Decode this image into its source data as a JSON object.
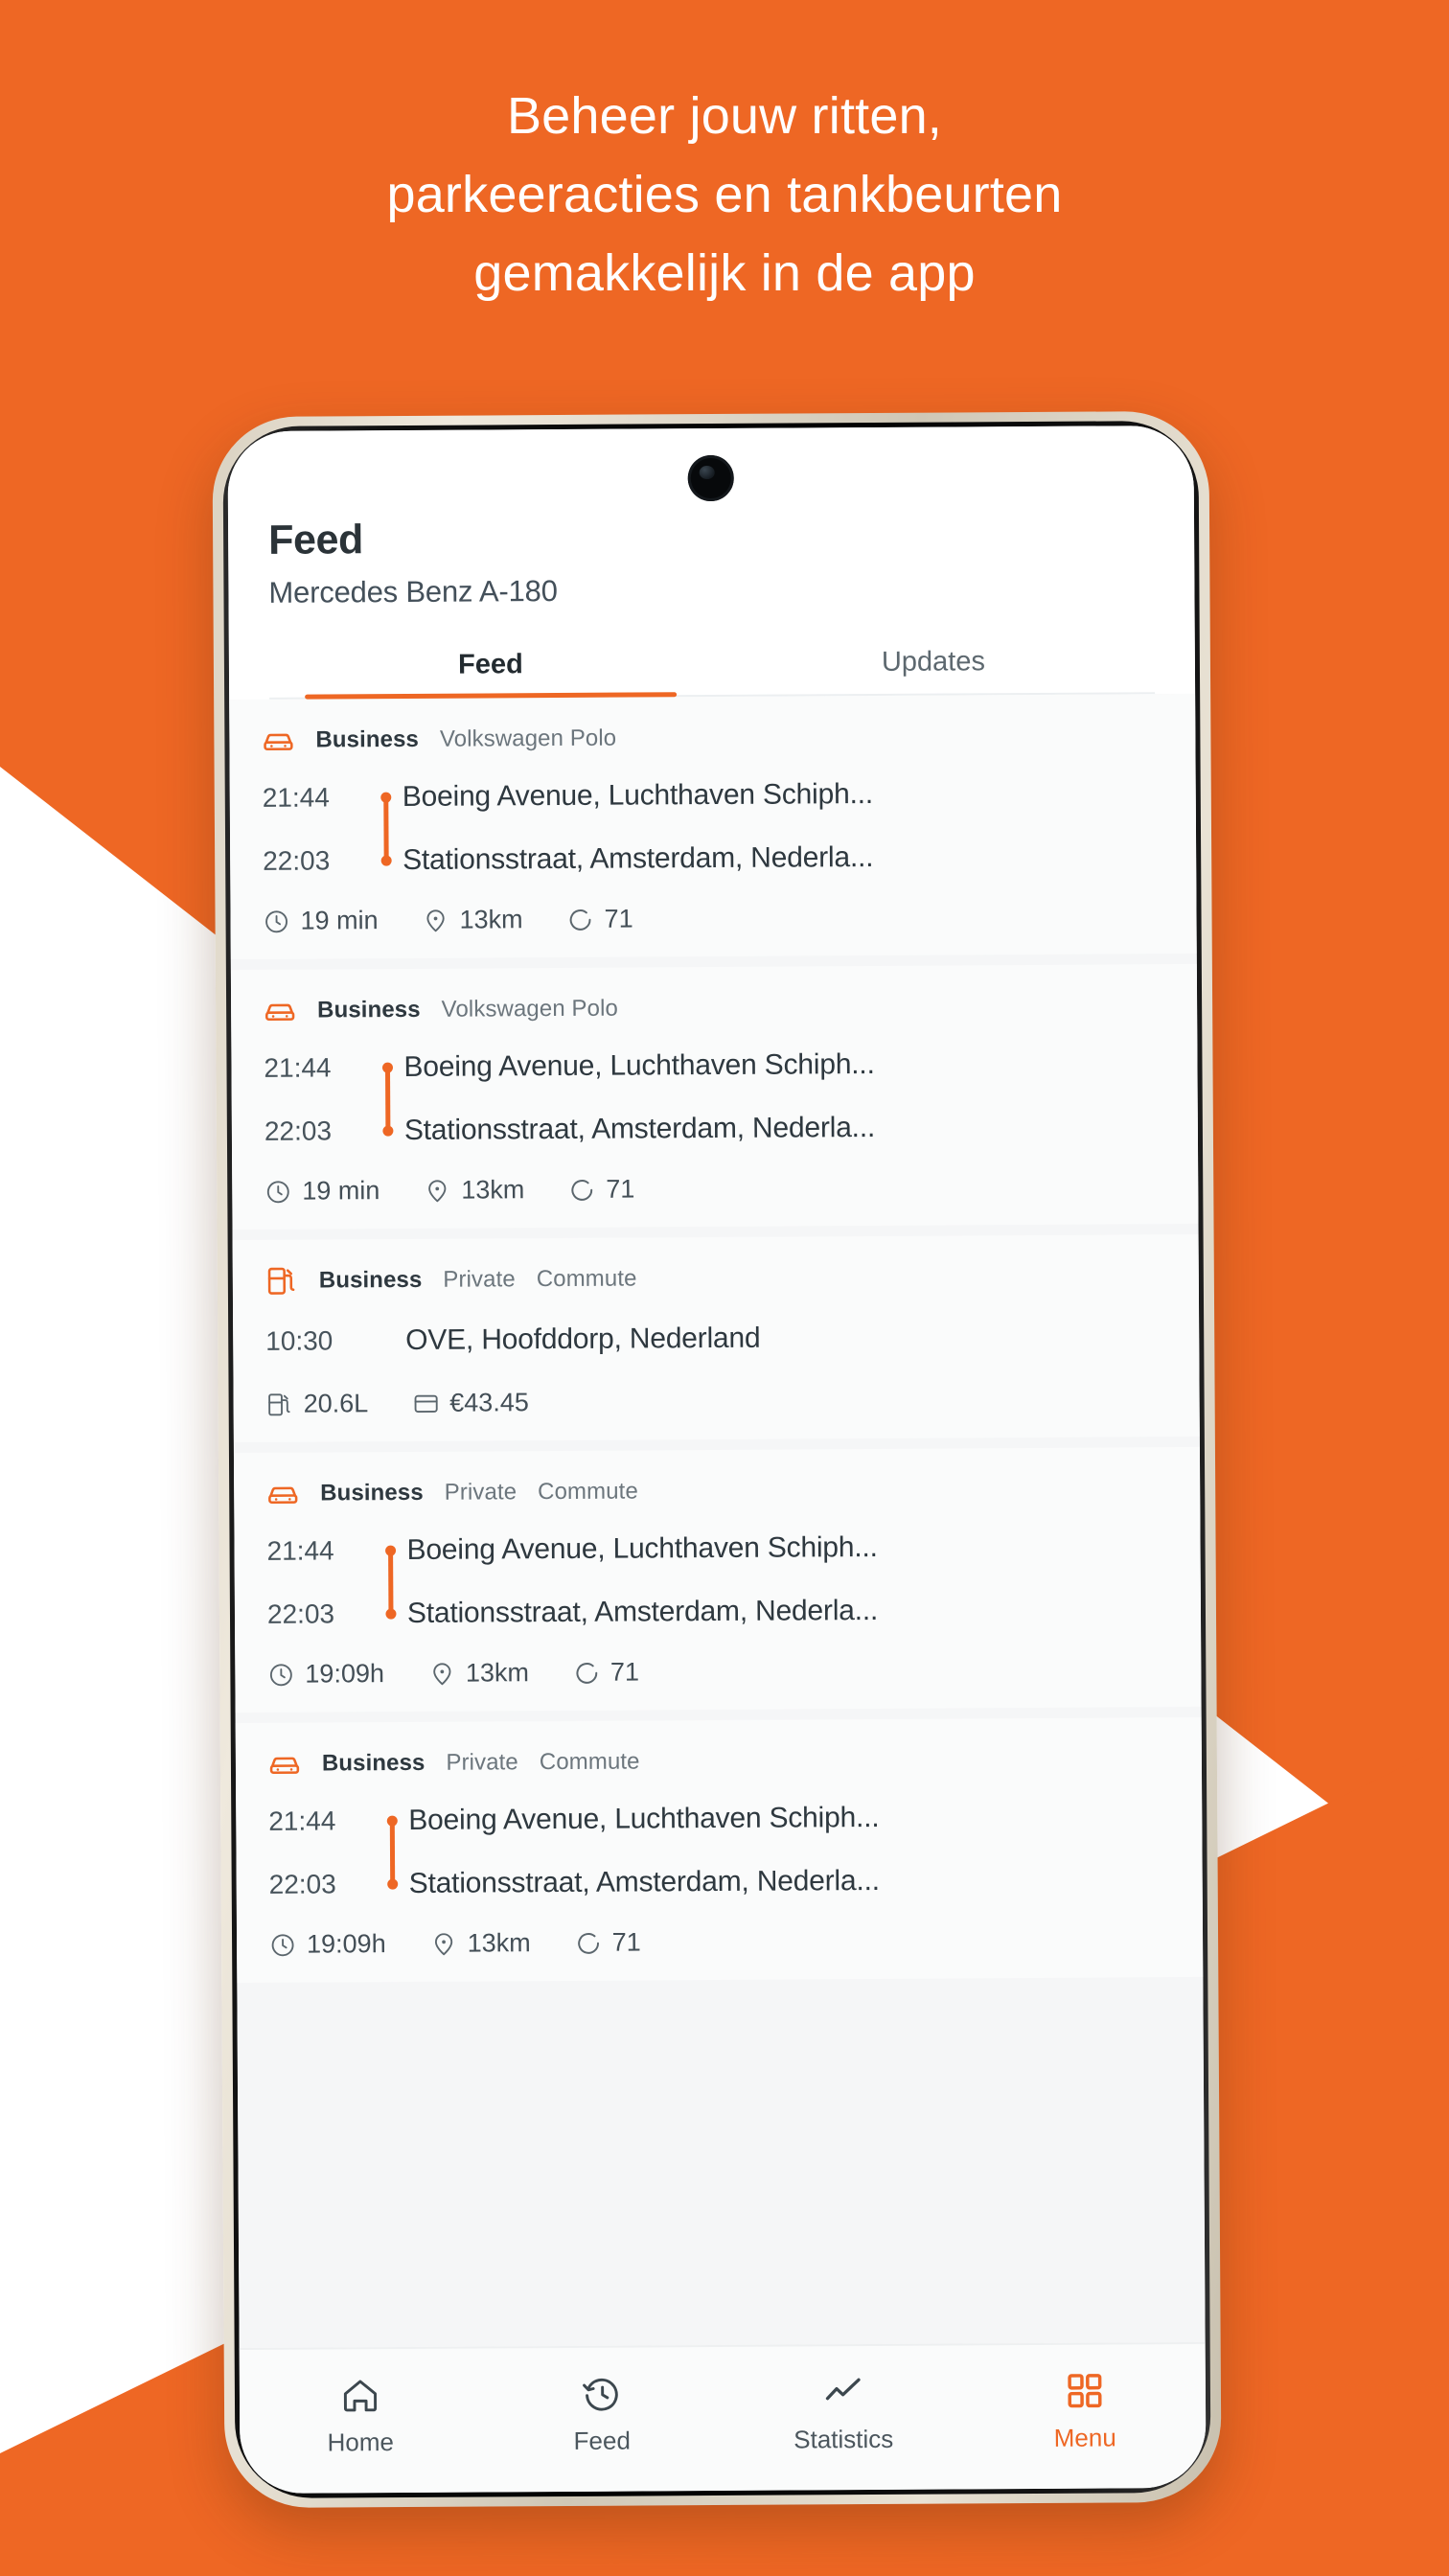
{
  "colors": {
    "brand_orange": "#ee6724",
    "background_white": "#ffffff",
    "text_dark": "#2e383f",
    "text_muted": "#6c767d"
  },
  "headline": {
    "lines": [
      "Beheer jouw ritten,",
      "parkeeracties en tankbeurten",
      "gemakkelijk in de app"
    ]
  },
  "app": {
    "title": "Feed",
    "subtitle": "Mercedes Benz A-180",
    "tabs": [
      {
        "label": "Feed",
        "active": true
      },
      {
        "label": "Updates",
        "active": false
      }
    ],
    "cards": [
      {
        "type": "trip",
        "icon": "car-icon",
        "tags": [
          "Business",
          "Volkswagen Polo"
        ],
        "start_time": "21:44",
        "start_address": "Boeing Avenue, Luchthaven Schiph...",
        "end_time": "22:03",
        "end_address": "Stationsstraat, Amsterdam, Nederla...",
        "duration": "19 min",
        "distance": "13km",
        "score": "71"
      },
      {
        "type": "trip",
        "icon": "car-icon",
        "tags": [
          "Business",
          "Volkswagen Polo"
        ],
        "start_time": "21:44",
        "start_address": "Boeing Avenue, Luchthaven Schiph...",
        "end_time": "22:03",
        "end_address": "Stationsstraat, Amsterdam, Nederla...",
        "duration": "19 min",
        "distance": "13km",
        "score": "71"
      },
      {
        "type": "fuel",
        "icon": "fuel-pump-icon",
        "tags": [
          "Business",
          "Private",
          "Commute"
        ],
        "time": "10:30",
        "address": "OVE, Hoofddorp, Nederland",
        "volume": "20.6L",
        "amount": "€43.45"
      },
      {
        "type": "trip",
        "icon": "car-icon",
        "tags": [
          "Business",
          "Private",
          "Commute"
        ],
        "start_time": "21:44",
        "start_address": "Boeing Avenue, Luchthaven Schiph...",
        "end_time": "22:03",
        "end_address": "Stationsstraat, Amsterdam, Nederla...",
        "duration": "19:09h",
        "distance": "13km",
        "score": "71"
      },
      {
        "type": "trip",
        "icon": "car-icon",
        "tags": [
          "Business",
          "Private",
          "Commute"
        ],
        "start_time": "21:44",
        "start_address": "Boeing Avenue, Luchthaven Schiph...",
        "end_time": "22:03",
        "end_address": "Stationsstraat, Amsterdam, Nederla...",
        "duration": "19:09h",
        "distance": "13km",
        "score": "71"
      }
    ],
    "bottom_nav": [
      {
        "label": "Home",
        "icon": "home-icon",
        "active": false
      },
      {
        "label": "Feed",
        "icon": "history-clock-icon",
        "active": false
      },
      {
        "label": "Statistics",
        "icon": "line-chart-icon",
        "active": false
      },
      {
        "label": "Menu",
        "icon": "grid-menu-icon",
        "active": true
      }
    ]
  }
}
